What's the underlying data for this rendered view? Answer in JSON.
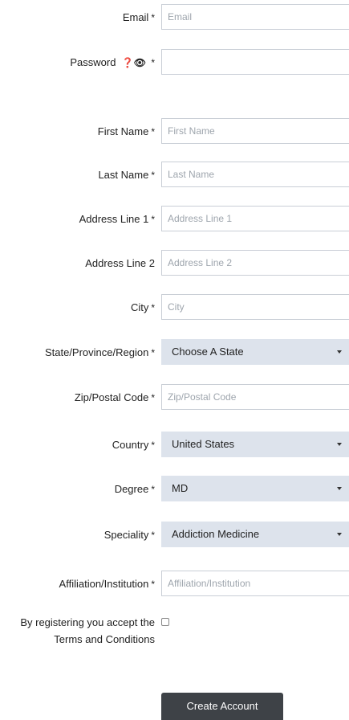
{
  "form": {
    "required_marker": "*",
    "email": {
      "label": "Email",
      "placeholder": "Email"
    },
    "password": {
      "label": "Password",
      "icons_text": "❓👁",
      "placeholder": ""
    },
    "first_name": {
      "label": "First Name",
      "placeholder": "First Name"
    },
    "last_name": {
      "label": "Last Name",
      "placeholder": "Last Name"
    },
    "address1": {
      "label": "Address Line 1",
      "placeholder": "Address Line 1"
    },
    "address2": {
      "label": "Address Line 2",
      "placeholder": "Address Line 2"
    },
    "city": {
      "label": "City",
      "placeholder": "City"
    },
    "state": {
      "label": "State/Province/Region",
      "selected": "Choose A State"
    },
    "zip": {
      "label": "Zip/Postal Code",
      "placeholder": "Zip/Postal Code"
    },
    "country": {
      "label": "Country",
      "selected": "United States"
    },
    "degree": {
      "label": "Degree",
      "selected": "MD"
    },
    "speciality": {
      "label": "Speciality",
      "selected": "Addiction Medicine"
    },
    "affiliation": {
      "label": "Affiliation/Institution",
      "placeholder": "Affiliation/Institution"
    },
    "terms": {
      "label": "By registering you accept the Terms and Conditions",
      "checked": false
    },
    "submit_label": "Create Account"
  },
  "icons": {
    "password_help": "question-circle-icon",
    "password_show": "eye-icon",
    "select_caret": "caret-down-icon"
  }
}
